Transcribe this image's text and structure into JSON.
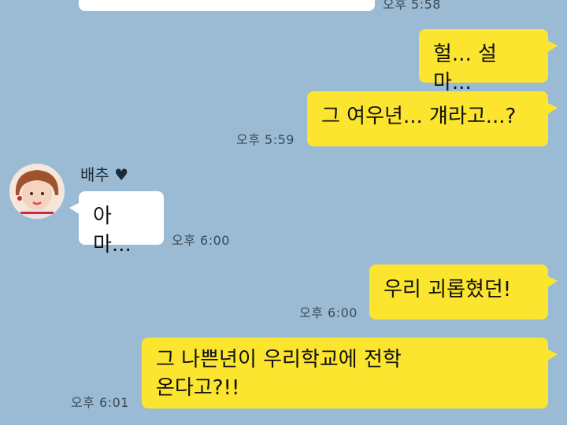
{
  "messages": [
    {
      "side": "them",
      "text": "",
      "time": "오후 5:58"
    },
    {
      "side": "me",
      "text": "헐... 설마...",
      "time": ""
    },
    {
      "side": "me",
      "text": "그 여우년... 걔라고...?",
      "time": "오후 5:59"
    },
    {
      "side": "them",
      "sender": "배추 ♥",
      "text": "아마...",
      "time": "오후 6:00"
    },
    {
      "side": "me",
      "text": "우리 괴롭혔던!",
      "time": "오후 6:00"
    },
    {
      "side": "me",
      "text": "그 나쁜년이 우리학교에 전학\n온다고?!!",
      "time": "오후 6:01"
    }
  ],
  "colors": {
    "background": "#9bbbd4",
    "my_bubble": "#fbe52e",
    "their_bubble": "#ffffff"
  },
  "icons": {
    "avatar": "profile-photo"
  }
}
